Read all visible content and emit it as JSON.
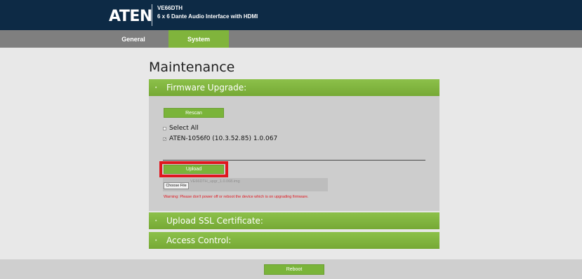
{
  "header": {
    "logo": "ATEN",
    "model": "VE66DTH",
    "subtitle": "6 x 6 Dante Audio Interface with HDMI"
  },
  "tabs": [
    {
      "label": "General",
      "active": false
    },
    {
      "label": "System",
      "active": true
    }
  ],
  "page_title": "Maintenance",
  "sections": {
    "firmware": {
      "label": "Firmware Upgrade:",
      "bullet": "•"
    },
    "ssl": {
      "label": "Upload SSL Certificate:",
      "bullet": "•"
    },
    "access": {
      "label": "Access Control:",
      "bullet": "•"
    }
  },
  "firmware": {
    "rescan_label": "Rescan",
    "select_all_label": "Select All",
    "select_all_checked": false,
    "device_label": "ATEN-1056f0 (10.3.52.85) 1.0.067",
    "device_checked": true,
    "upload_label": "Upload",
    "choose_file_label": "Choose File",
    "file_name": "VE66DTH_upgr_1.0.068.img",
    "warning": "Warning: Please don't power off or reboot the device which is on upgrading firmware."
  },
  "footer": {
    "reboot_label": "Reboot"
  },
  "colors": {
    "header_bg": "#0d2a45",
    "accent_green": "#80b43c",
    "tabbar_gray": "#7f7f7f",
    "highlight_red": "#e0171f",
    "warning_red": "#e0171f"
  }
}
